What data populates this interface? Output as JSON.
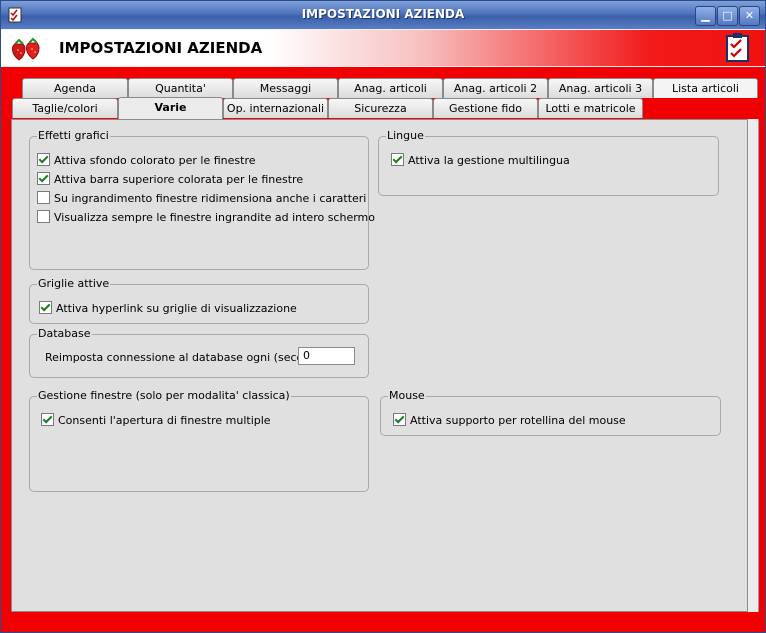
{
  "window": {
    "title": "IMPOSTAZIONI AZIENDA",
    "min_glyph": "▁",
    "max_glyph": "□",
    "close_glyph": "✕"
  },
  "header": {
    "title": "IMPOSTAZIONI AZIENDA"
  },
  "tabs": {
    "row1": [
      "Agenda",
      "Quantita'",
      "Messaggi",
      "Anag. articoli",
      "Anag. articoli 2",
      "Anag. articoli 3",
      "Lista articoli"
    ],
    "row2": [
      "Taglie/colori",
      "Varie",
      "Op. internazionali",
      "Sicurezza",
      "Gestione fido",
      "Lotti e matricole"
    ],
    "active": "Varie"
  },
  "groups": {
    "effetti": {
      "label": "Effetti grafici",
      "items": [
        {
          "label": "Attiva sfondo colorato per le finestre",
          "checked": true
        },
        {
          "label": "Attiva barra superiore colorata per le finestre",
          "checked": true
        },
        {
          "label": "Su ingrandimento finestre ridimensiona anche i caratteri",
          "checked": false
        },
        {
          "label": "Visualizza sempre le finestre ingrandite ad intero schermo",
          "checked": false
        }
      ]
    },
    "lingue": {
      "label": "Lingue",
      "items": [
        {
          "label": "Attiva la gestione multilingua",
          "checked": true
        }
      ]
    },
    "griglie": {
      "label": "Griglie attive",
      "items": [
        {
          "label": "Attiva hyperlink su griglie di visualizzazione",
          "checked": true
        }
      ]
    },
    "database": {
      "label": "Database",
      "field_label": "Reimposta connessione al database ogni (secondi) :",
      "field_value": "0"
    },
    "finestre": {
      "label": "Gestione finestre (solo per modalita' classica)",
      "items": [
        {
          "label": "Consenti l'apertura di finestre multiple",
          "checked": true
        }
      ]
    },
    "mouse": {
      "label": "Mouse",
      "items": [
        {
          "label": "Attiva supporto per rotellina del mouse",
          "checked": true
        }
      ]
    }
  },
  "colors": {
    "title_blue": "#3b5fa8",
    "frame_red": "#f00000",
    "panel_gray": "#e0e0e0",
    "check_green": "#1f7a1f"
  }
}
